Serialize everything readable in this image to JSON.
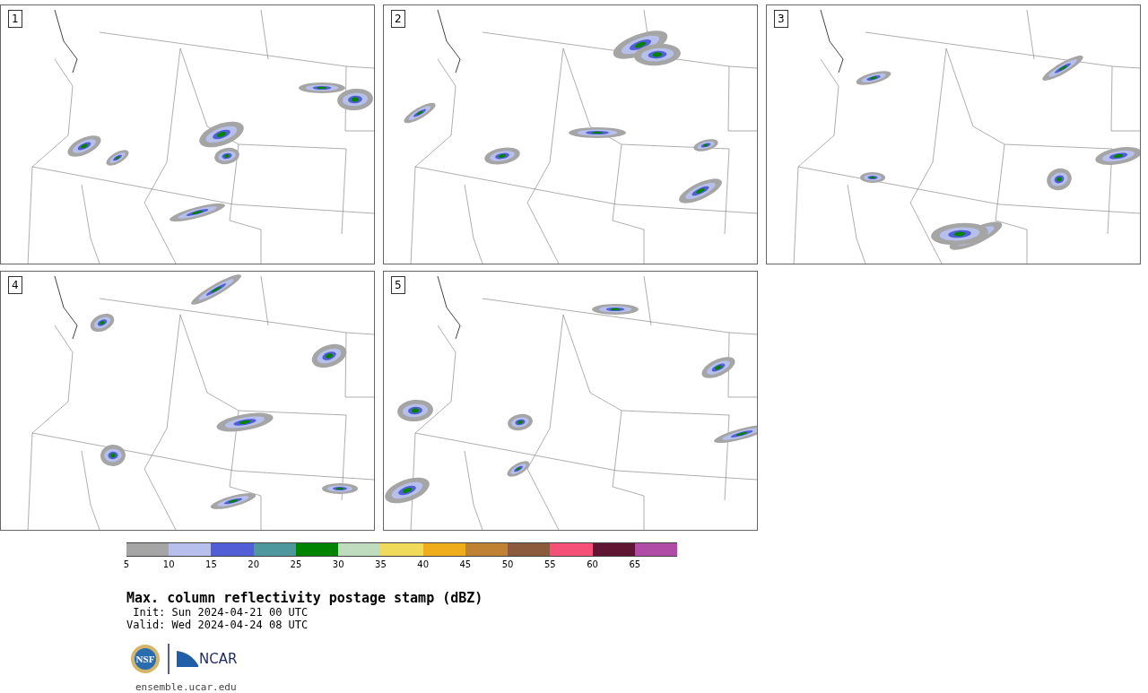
{
  "panels": [
    {
      "label": "1"
    },
    {
      "label": "2"
    },
    {
      "label": "3"
    },
    {
      "label": "4"
    },
    {
      "label": "5"
    }
  ],
  "colorbar": {
    "segments": [
      {
        "color": "#a5a5a5"
      },
      {
        "color": "#b7c0ec"
      },
      {
        "color": "#515ed6"
      },
      {
        "color": "#4f979f"
      },
      {
        "color": "#008300"
      },
      {
        "color": "#c0dcbe"
      },
      {
        "color": "#f0da5b"
      },
      {
        "color": "#f0ad1b"
      },
      {
        "color": "#be8232"
      },
      {
        "color": "#8c5a3c"
      },
      {
        "color": "#f55078"
      },
      {
        "color": "#601532"
      },
      {
        "color": "#b04ca6"
      }
    ],
    "ticks": [
      "5",
      "10",
      "15",
      "20",
      "25",
      "30",
      "35",
      "40",
      "45",
      "50",
      "55",
      "60",
      "65"
    ]
  },
  "title": "Max. column reflectivity postage stamp (dBZ)",
  "init": " Init: Sun 2024-04-21 00 UTC",
  "valid": "Valid: Wed 2024-04-24 08 UTC",
  "logos": {
    "nsf": "NSF",
    "ncar": "NCAR"
  },
  "url": "ensemble.ucar.edu"
}
